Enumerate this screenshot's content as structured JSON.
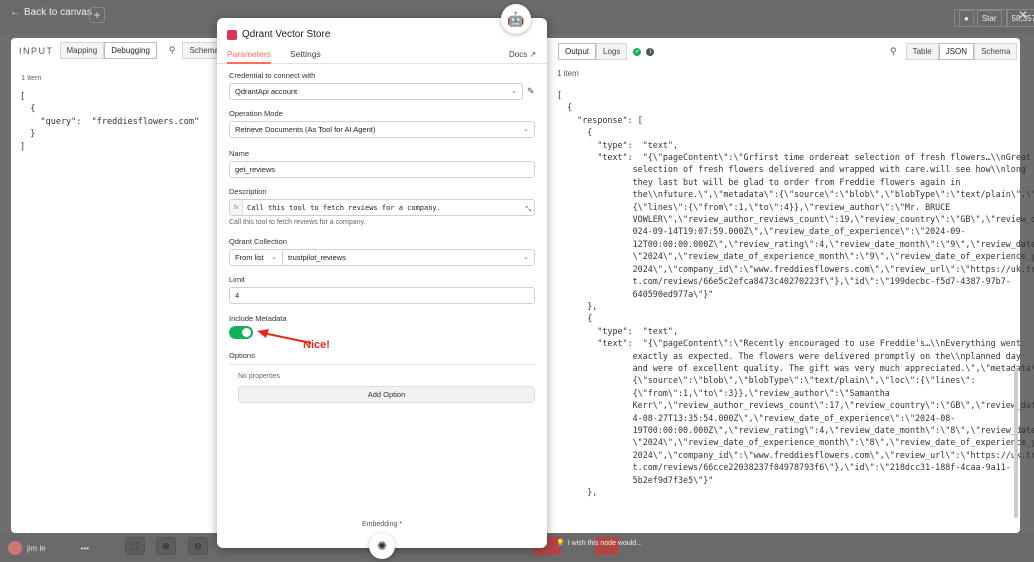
{
  "topbar": {
    "back_label": "Back to canvas",
    "plus_label": "+",
    "star_label": "Star",
    "star_count": "58,357",
    "close": "✕"
  },
  "input_panel": {
    "title": "INPUT",
    "tabs": [
      "Mapping",
      "Debugging",
      "Schema"
    ],
    "active_tab": "Debugging",
    "item_count": "1 item",
    "json_lines": [
      "[",
      "  {",
      "    \"query\":  \"freddiesflowers.com\"",
      "  }",
      "]"
    ]
  },
  "node": {
    "title": "Qdrant Vector Store",
    "tabs": [
      "Parameters",
      "Settings"
    ],
    "docs_label": "Docs",
    "credential_label": "Credential to connect with",
    "credential_value": "QdrantApi account",
    "operation_label": "Operation Mode",
    "operation_value": "Retrieve Documents (As Tool for AI Agent)",
    "name_label": "Name",
    "name_value": "get_reviews",
    "description_label": "Description",
    "description_fx": "fx",
    "description_value": "Call this tool to fetch reviews for a company.",
    "description_hint": "Call this tool to fetch reviews for a company.",
    "collection_label": "Qdrant Collection",
    "collection_mode": "From list",
    "collection_value": "trustpilot_reviews",
    "limit_label": "Limit",
    "limit_value": "4",
    "metadata_label": "Include Metadata",
    "metadata_on": true,
    "annotation": "Nice!",
    "options_label": "Options",
    "no_properties": "No properties",
    "add_option": "Add Option",
    "embedding_label": "Embedding *"
  },
  "output_panel": {
    "tabs": [
      "Output",
      "Logs"
    ],
    "active_tab": "Output",
    "view_tabs": [
      "Table",
      "JSON",
      "Schema"
    ],
    "active_view": "JSON",
    "item_count": "1 item",
    "json_lines": [
      "[",
      "  {",
      "    \"response\": [",
      "      {",
      "        \"type\":  \"text\",",
      "        \"text\":  \"{\\\"pageContent\\\":\\\"Grfirst time ordereat selection of fresh flowers…\\\\nGreat",
      "               selection of fresh flowers delivered and wrapped with care.will see how\\\\nlong",
      "               they last but will be glad to order from Freddie flowers again in",
      "               the\\\\nfuture.\\\",\\\"metadata\\\":{\\\"source\\\":\\\"blob\\\",\\\"blobType\\\":\\\"text/plain\\\",\\\"loc\\\":",
      "               {\\\"lines\\\":{\\\"from\\\":1,\\\"to\\\":4}},\\\"review_author\\\":\\\"Mr. BRUCE",
      "               VOWLER\\\",\\\"review_author_reviews_count\\\":19,\\\"review_country\\\":\\\"GB\\\",\\\"review_date\\\":\\\"2",
      "               024-09-14T19:07:59.000Z\\\",\\\"review_date_of_experience\\\":\\\"2024-09-",
      "               12T00:00:00.000Z\\\",\\\"review_rating\\\":4,\\\"review_date_month\\\":\\\"9\\\",\\\"review_date_year\\\":",
      "               \\\"2024\\\",\\\"review_date_of_experience_month\\\":\\\"9\\\",\\\"review_date_of_experience_year\\\":\\\"",
      "               2024\\\",\\\"company_id\\\":\\\"www.freddiesflowers.com\\\",\\\"review_url\\\":\\\"https://uk.trustpilo",
      "               t.com/reviews/66e5c2efca8473c40270223f\\\"},\\\"id\\\":\\\"199decbc-f5d7-4387-97b7-",
      "               640590ed977a\\\"}\"",
      "      },",
      "      {",
      "        \"type\":  \"text\",",
      "        \"text\":  \"{\\\"pageContent\\\":\\\"Recently encouraged to use Freddie's…\\\\nEverything went",
      "               exactly as expected. The flowers were delivered promptly on the\\\\nplanned day",
      "               and were of excellent quality. The gift was very much appreciated.\\\",\\\"metadata\\\":",
      "               {\\\"source\\\":\\\"blob\\\",\\\"blobType\\\":\\\"text/plain\\\",\\\"loc\\\":{\\\"lines\\\":",
      "               {\\\"from\\\":1,\\\"to\\\":3}},\\\"review_author\\\":\\\"Samantha",
      "               Kerr\\\",\\\"review_author_reviews_count\\\":17,\\\"review_country\\\":\\\"GB\\\",\\\"review_date\\\":\\\"202",
      "               4-08-27T13:35:54.000Z\\\",\\\"review_date_of_experience\\\":\\\"2024-08-",
      "               19T00:00:00.000Z\\\",\\\"review_rating\\\":4,\\\"review_date_month\\\":\\\"8\\\",\\\"review_date_year\\\":",
      "               \\\"2024\\\",\\\"review_date_of_experience_month\\\":\\\"8\\\",\\\"review_date_of_experience_year\\\":\\\"",
      "               2024\\\",\\\"company_id\\\":\\\"www.freddiesflowers.com\\\",\\\"review_url\\\":\\\"https://uk.trustpilo",
      "               t.com/reviews/66cce22038237f04978793f6\\\"},\\\"id\\\":\\\"218dcc31-188f-4caa-9a11-",
      "               5b2ef9d7f3e5\\\"}\"",
      "      },"
    ]
  },
  "bottombar": {
    "user_name": "jim le",
    "wish_text": "I wish this node would..."
  },
  "colors": {
    "accent": "#ff6d5a",
    "toggle_on": "#13b05a",
    "annotation": "#e22b1f",
    "status_ok": "#21b35a"
  }
}
